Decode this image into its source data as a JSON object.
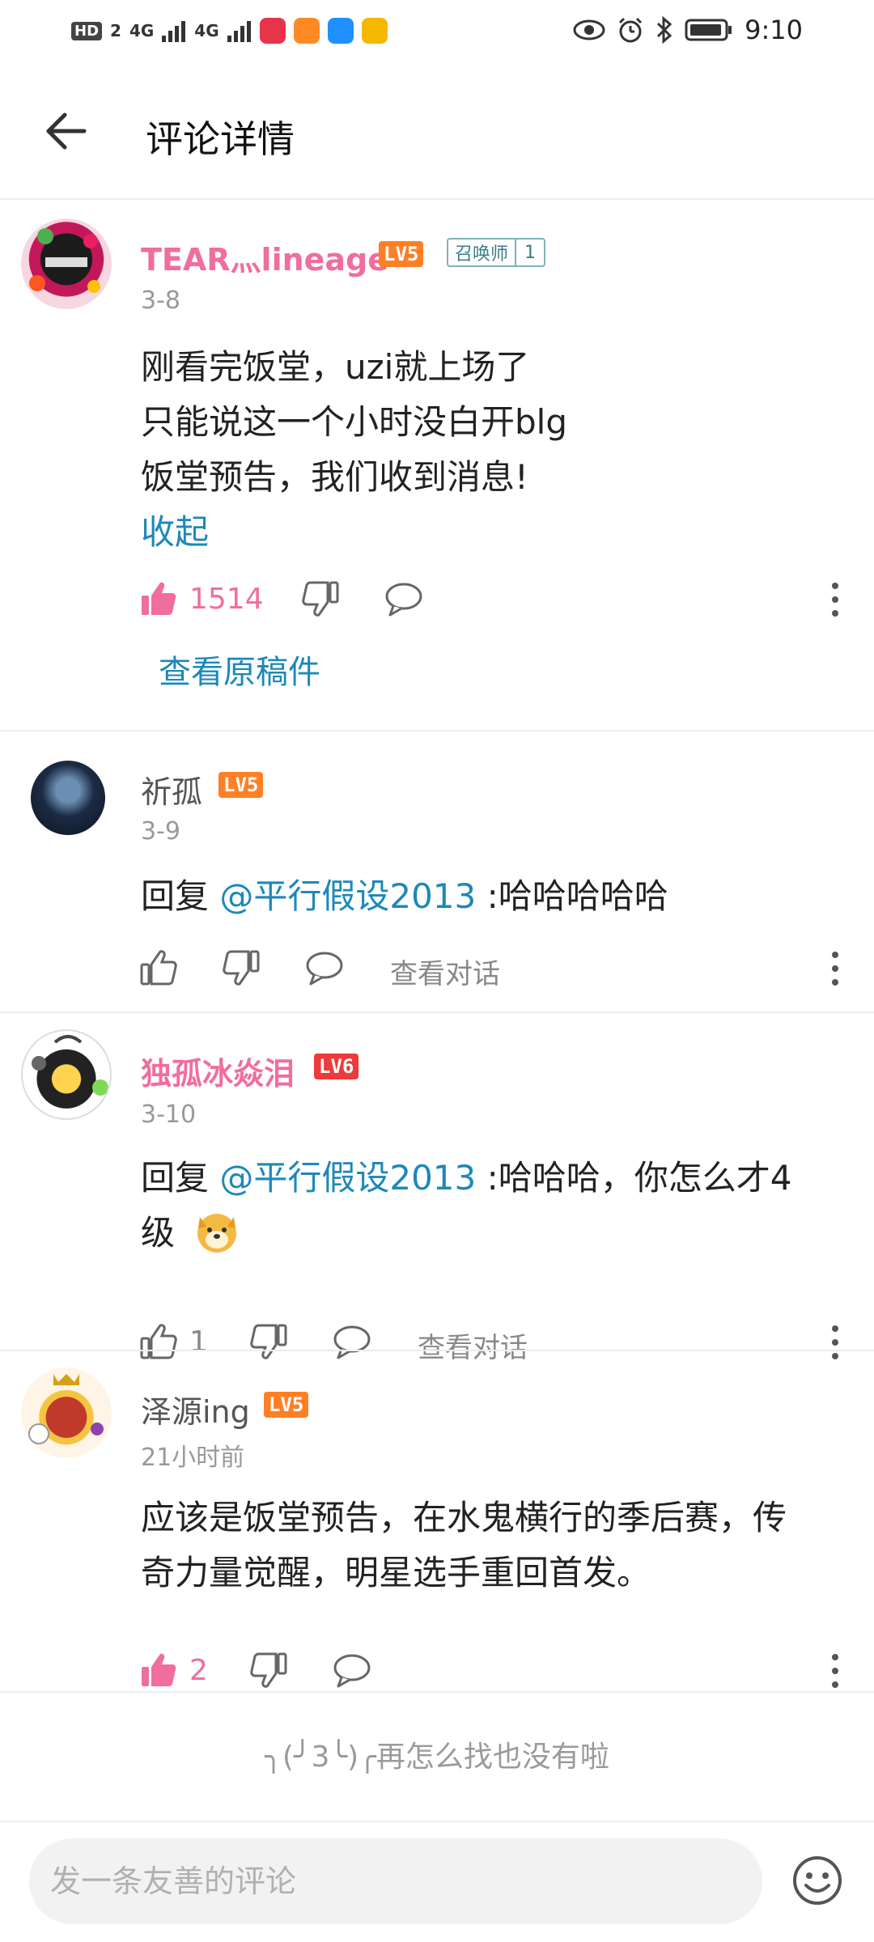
{
  "status_bar": {
    "left_chips": [
      "HD",
      "2",
      "4G",
      "4G"
    ],
    "time": "9:10"
  },
  "header": {
    "title": "评论详情"
  },
  "comments": [
    {
      "username": "TEAR灬lineage",
      "level": "LV5",
      "medal_name": "召唤师",
      "medal_level": "1",
      "date": "3-8",
      "lines": [
        "刚看完饭堂，uzi就上场了",
        "只能说这一个小时没白开blg",
        "饭堂预告，我们收到消息!"
      ],
      "collapse_label": "收起",
      "like_count": "1514",
      "view_original_label": "查看原稿件"
    },
    {
      "username": "祈孤",
      "level": "LV5",
      "date": "3-9",
      "reply_prefix": "回复 ",
      "mention": "@平行假设2013",
      "reply_text": " :哈哈哈哈哈",
      "view_thread_label": "查看对话"
    },
    {
      "username": "独孤冰焱泪",
      "level": "LV6",
      "date": "3-10",
      "reply_prefix": "回复 ",
      "mention": "@平行假设2013",
      "reply_text": " :哈哈哈，你怎么才4",
      "reply_text_line2": "级",
      "like_count": "1",
      "view_thread_label": "查看对话"
    },
    {
      "username": "泽源ing",
      "level": "LV5",
      "date": "21小时前",
      "lines": [
        "应该是饭堂预告，在水鬼横行的季后赛，传",
        "奇力量觉醒，明星选手重回首发。"
      ],
      "like_count": "2"
    }
  ],
  "end_message": "╮(╯3╰)╭再怎么找也没有啦",
  "bottom_bar": {
    "input_placeholder": "发一条友善的评论"
  },
  "colors": {
    "accent_pink": "#f06e9e",
    "link_blue": "#1e88b9",
    "lv5": "#ff7f24",
    "lv6": "#ee3a3a"
  },
  "icons": [
    "back-arrow-icon",
    "thumbs-up-icon",
    "thumbs-down-icon",
    "reply-bubble-icon",
    "more-vertical-icon",
    "emoji-icon"
  ]
}
